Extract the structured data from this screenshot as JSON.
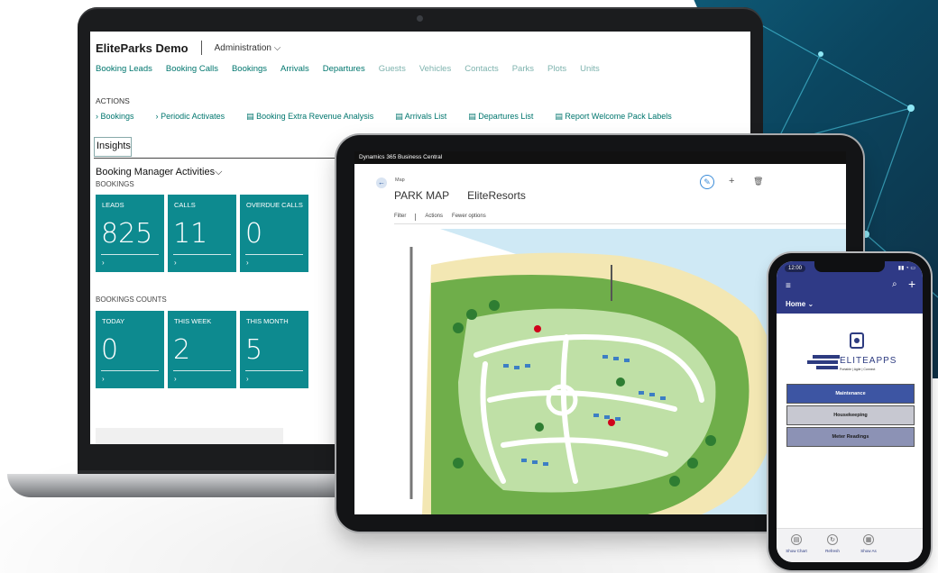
{
  "laptop": {
    "company": "EliteParks Demo",
    "role_center": "Administration",
    "nav": [
      {
        "label": "Booking Leads",
        "dim": false
      },
      {
        "label": "Booking Calls",
        "dim": false
      },
      {
        "label": "Bookings",
        "dim": false
      },
      {
        "label": "Arrivals",
        "dim": false
      },
      {
        "label": "Departures",
        "dim": false
      },
      {
        "label": "Guests",
        "dim": true
      },
      {
        "label": "Vehicles",
        "dim": true
      },
      {
        "label": "Contacts",
        "dim": true
      },
      {
        "label": "Parks",
        "dim": true
      },
      {
        "label": "Plots",
        "dim": true
      },
      {
        "label": "Units",
        "dim": true
      }
    ],
    "actions_title": "ACTIONS",
    "actions": [
      "Bookings",
      "Periodic Activates",
      "Booking Extra Revenue Analysis",
      "Arrivals List",
      "Departures List",
      "Report Welcome Pack Labels"
    ],
    "insights_label": "Insights",
    "activities_title": "Booking Manager Activities",
    "bookings_caption": "BOOKINGS",
    "bookings_tiles": [
      {
        "label": "LEADS",
        "value": "825"
      },
      {
        "label": "CALLS",
        "value": "11"
      },
      {
        "label": "OVERDUE CALLS",
        "value": "0"
      }
    ],
    "counts_caption": "BOOKINGS COUNTS",
    "counts_tiles": [
      {
        "label": "TODAY",
        "value": "0"
      },
      {
        "label": "THIS WEEK",
        "value": "2"
      },
      {
        "label": "THIS MONTH",
        "value": "5"
      }
    ],
    "tile_color": "#0d8a8f"
  },
  "tablet": {
    "app_title": "Dynamics 365 Business Central",
    "page_caption": "Map",
    "page_title": "PARK MAP",
    "park_name": "EliteResorts",
    "menu": [
      "Filter",
      "Actions",
      "Fewer options"
    ]
  },
  "phone": {
    "time": "12:00",
    "home_label": "Home",
    "brand_name": "ELITEAPPS",
    "brand_tagline": "Portable | Agile | Connect",
    "buttons": [
      {
        "label": "Maintenance",
        "color": "#3d55a3",
        "text_color": "#ffffff"
      },
      {
        "label": "Housekeeping",
        "color": "#c7c8d1",
        "text_color": "#1b1b1b"
      },
      {
        "label": "Meter Readings",
        "color": "#8c92b5",
        "text_color": "#1b1b1b"
      }
    ],
    "tabs": [
      "Show Chart",
      "Refresh",
      "Show As"
    ],
    "accent_color": "#2f3a86"
  }
}
